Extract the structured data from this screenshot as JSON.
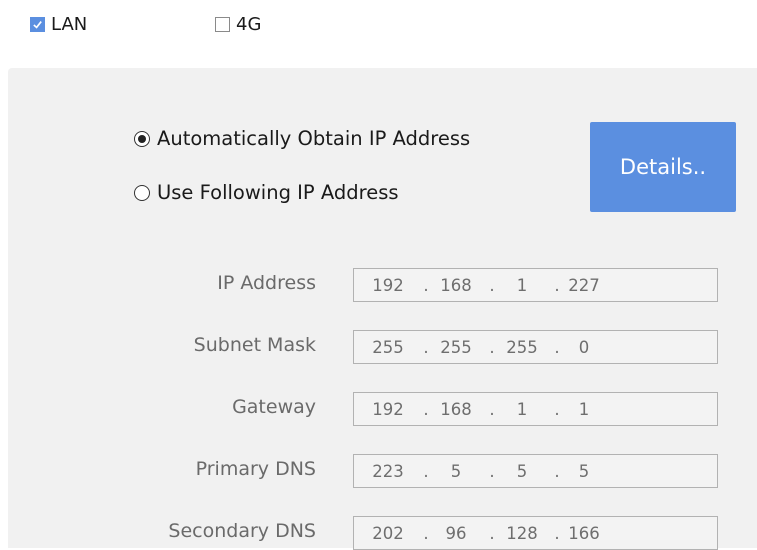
{
  "connection_types": {
    "lan": {
      "label": "LAN",
      "checked": true
    },
    "g4": {
      "label": "4G",
      "checked": false
    }
  },
  "ip_mode": {
    "auto_label": "Automatically Obtain IP Address",
    "manual_label": "Use Following IP Address",
    "selected": "auto"
  },
  "details_button": {
    "label": "Details.."
  },
  "fields": {
    "ip_address": {
      "label": "IP Address",
      "octets": [
        "192",
        "168",
        "1",
        "227"
      ]
    },
    "subnet_mask": {
      "label": "Subnet Mask",
      "octets": [
        "255",
        "255",
        "255",
        "0"
      ]
    },
    "gateway": {
      "label": "Gateway",
      "octets": [
        "192",
        "168",
        "1",
        "1"
      ]
    },
    "primary_dns": {
      "label": "Primary DNS",
      "octets": [
        "223",
        "5",
        "5",
        "5"
      ]
    },
    "secondary_dns": {
      "label": "Secondary DNS",
      "octets": [
        "202",
        "96",
        "128",
        "166"
      ]
    }
  },
  "separator": ".",
  "colors": {
    "accent": "#5b8fe0",
    "panel_bg": "#f1f1f1",
    "field_border": "#b2b2b2",
    "label_text": "#6a6a6a"
  }
}
